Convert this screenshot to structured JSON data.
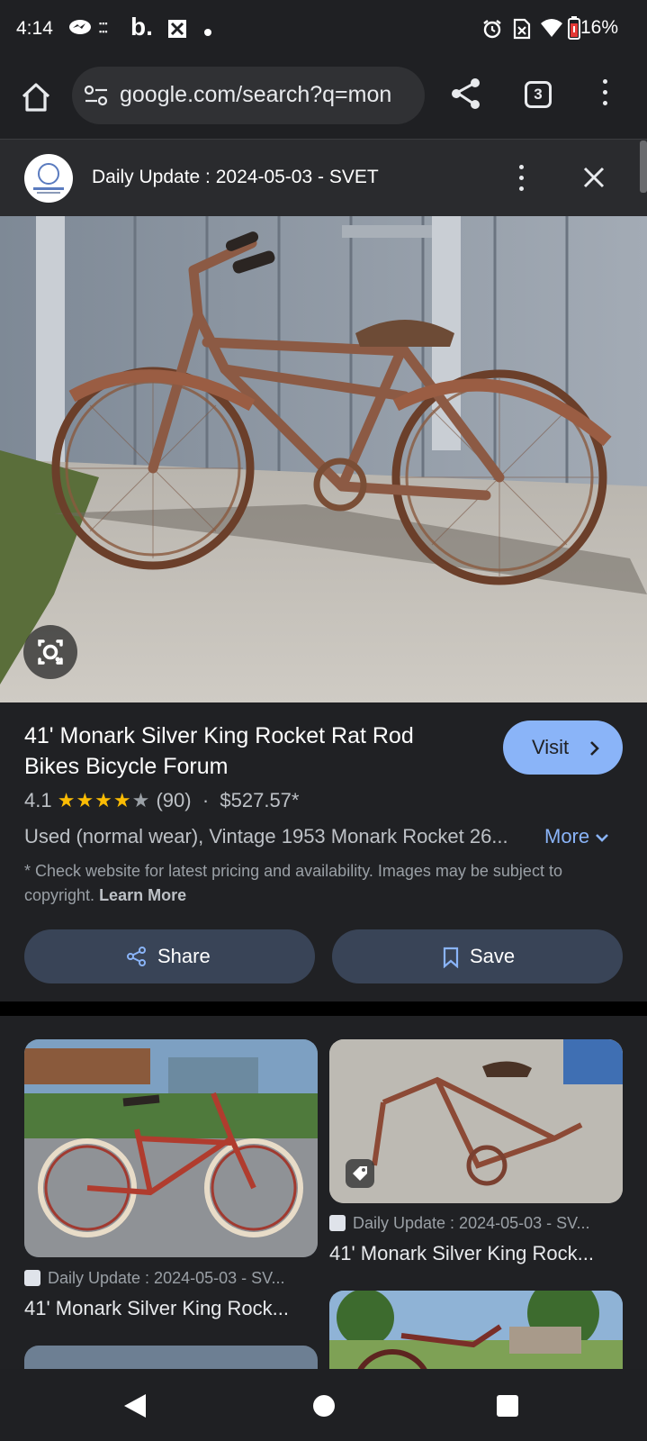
{
  "status_bar": {
    "time": "4:14",
    "battery": "16%",
    "left_icons": [
      "messenger-icon",
      "temu-icon",
      "booking-icon",
      "app-icon",
      "dot-icon"
    ],
    "right_icons": [
      "alarm-icon",
      "no-sim-icon",
      "wifi-icon",
      "battery-low-icon"
    ]
  },
  "browser": {
    "url": "google.com/search?q=mon",
    "tab_count": "3"
  },
  "page_header": {
    "title": "Daily Update : 2024-05-03 - SVET"
  },
  "product": {
    "title": "41' Monark Silver King Rocket Rat Rod Bikes Bicycle Forum",
    "visit_label": "Visit",
    "rating": "4.1",
    "stars": 4.1,
    "reviews": "(90)",
    "separator": "·",
    "price": "$527.57*",
    "description": "Used (normal wear), Vintage 1953 Monark Rocket 26...",
    "more_label": "More",
    "note": "* Check website for latest pricing and availability. Images may be subject to copyright.",
    "learn_more": "Learn More",
    "share_label": "Share",
    "save_label": "Save"
  },
  "related": [
    {
      "source": "Daily Update : 2024-05-03 - SV...",
      "title": "41' Monark Silver King Rock..."
    },
    {
      "source": "Daily Update : 2024-05-03 - SV...",
      "title": "41' Monark Silver King Rock..."
    }
  ],
  "colors": {
    "accent": "#8ab4f8",
    "background": "#202124",
    "star": "#fbbc04"
  }
}
